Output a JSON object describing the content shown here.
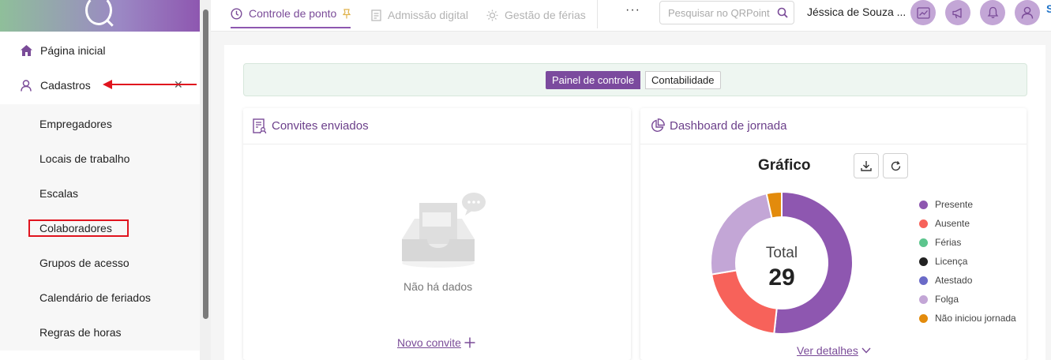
{
  "sidebar": {
    "home_label": "Página inicial",
    "cadastros_label": "Cadastros",
    "subitems": [
      "Empregadores",
      "Locais de trabalho",
      "Escalas",
      "Colaboradores",
      "Grupos de acesso",
      "Calendário de feriados",
      "Regras de horas"
    ]
  },
  "topbar": {
    "tabs": [
      "Controle de ponto",
      "Admissão digital",
      "Gestão de férias"
    ],
    "more_label": "···",
    "search_placeholder": "Pesquisar no QRPoint",
    "user_name": "Jéssica de Souza ..."
  },
  "switch": {
    "active": "Painel de controle",
    "inactive": "Contabilidade"
  },
  "invites_card": {
    "title": "Convites enviados",
    "empty_text": "Não há dados",
    "new_invite_label": "Novo convite"
  },
  "dashboard_card": {
    "title": "Dashboard de jornada",
    "chart_title": "Gráfico",
    "total_label": "Total",
    "total_value": "29",
    "details_label": "Ver detalhes"
  },
  "chart_data": {
    "type": "pie",
    "title": "Gráfico",
    "categories": [
      "Presente",
      "Ausente",
      "Férias",
      "Licença",
      "Atestado",
      "Folga",
      "Não iniciou jornada"
    ],
    "values": [
      15,
      6,
      0,
      0,
      0,
      7,
      1
    ],
    "colors": [
      "#8e57b0",
      "#f7625a",
      "#5cc58d",
      "#222222",
      "#6a6ac8",
      "#c3a6d6",
      "#e38b0c"
    ],
    "legend_position": "right",
    "total": 29
  },
  "colors": {
    "accent": "#8e57b0",
    "annotation_red": "#e0141e"
  }
}
